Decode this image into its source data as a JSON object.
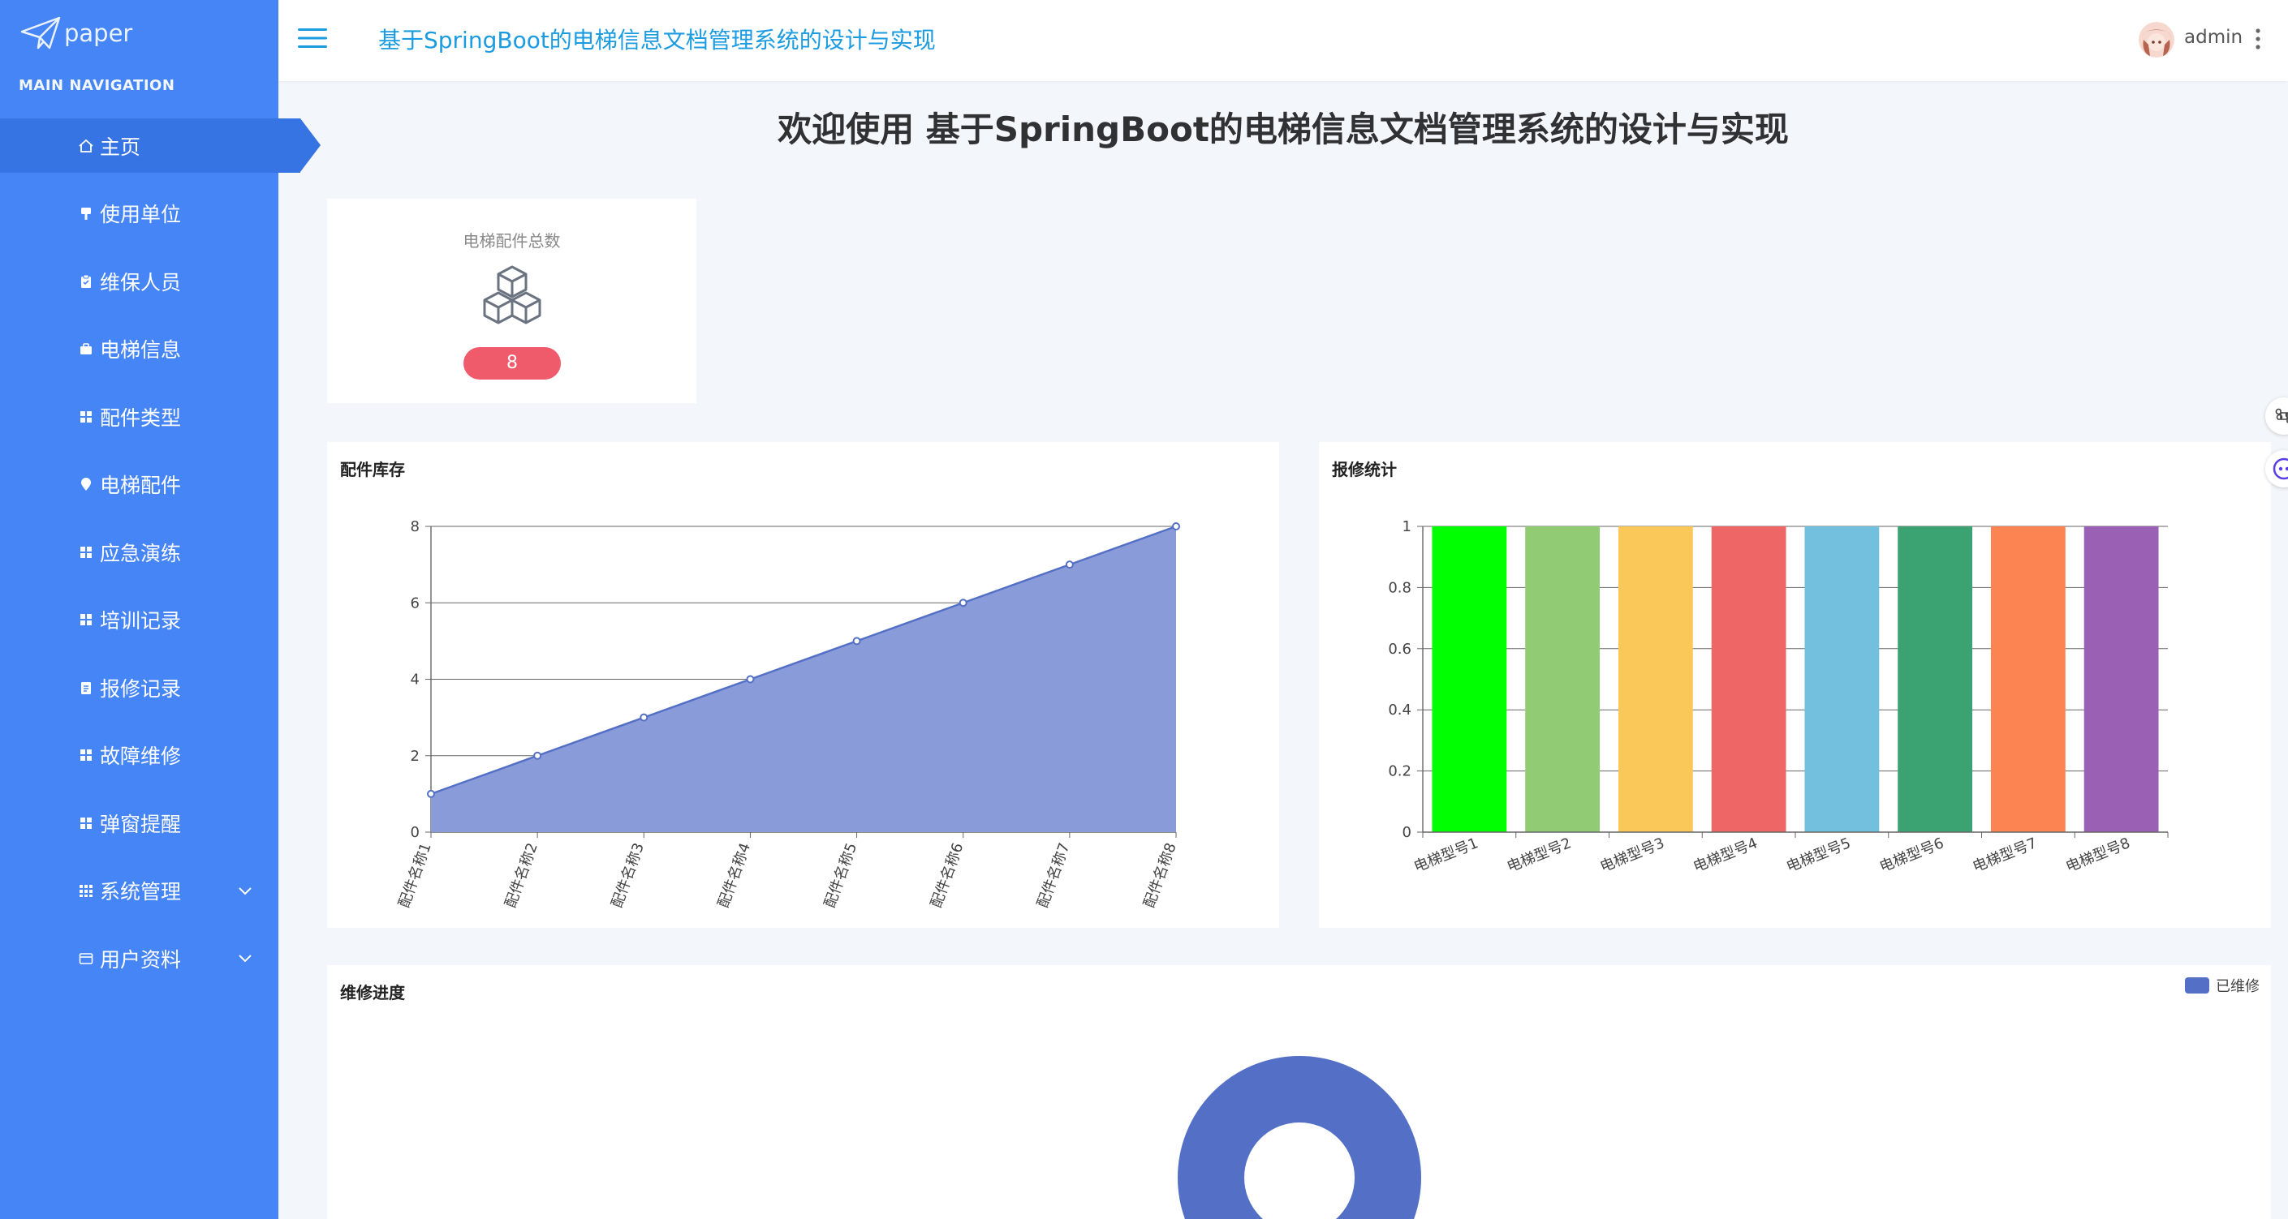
{
  "sidebar": {
    "logo_text": "paper",
    "heading": "MAIN NAVIGATION",
    "items": [
      {
        "label": "主页",
        "icon": "home-icon",
        "active": true
      },
      {
        "label": "使用单位",
        "icon": "flag-icon"
      },
      {
        "label": "维保人员",
        "icon": "clipboard-icon"
      },
      {
        "label": "电梯信息",
        "icon": "briefcase-icon"
      },
      {
        "label": "配件类型",
        "icon": "grid-icon"
      },
      {
        "label": "电梯配件",
        "icon": "map-pin-icon"
      },
      {
        "label": "应急演练",
        "icon": "grid-icon"
      },
      {
        "label": "培训记录",
        "icon": "grid-icon"
      },
      {
        "label": "报修记录",
        "icon": "document-icon"
      },
      {
        "label": "故障维修",
        "icon": "grid-icon"
      },
      {
        "label": "弹窗提醒",
        "icon": "grid-icon"
      },
      {
        "label": "系统管理",
        "icon": "grid-icon",
        "expandable": true
      },
      {
        "label": "用户资料",
        "icon": "card-icon",
        "expandable": true
      }
    ]
  },
  "header": {
    "title": "基于SpringBoot的电梯信息文档管理系统的设计与实现",
    "username": "admin"
  },
  "main": {
    "welcome": "欢迎使用 基于SpringBoot的电梯信息文档管理系统的设计与实现",
    "stat": {
      "label": "电梯配件总数",
      "value": "8"
    }
  },
  "colors": {
    "sidebar": "#4585f5",
    "sidebar_active": "#3674e4",
    "header_title": "#1b9be0",
    "badge": "#f05b6c",
    "line_fill": "#8a9bd9",
    "line_stroke": "#5470c6"
  },
  "chart_data": [
    {
      "type": "area",
      "title": "配件库存",
      "categories": [
        "配件名称1",
        "配件名称2",
        "配件名称3",
        "配件名称4",
        "配件名称5",
        "配件名称6",
        "配件名称7",
        "配件名称8"
      ],
      "values": [
        1,
        2,
        3,
        4,
        5,
        6,
        7,
        8
      ],
      "ylim": [
        0,
        8
      ],
      "yticks": [
        0,
        2,
        4,
        6,
        8
      ],
      "grid": true
    },
    {
      "type": "bar",
      "title": "报修统计",
      "categories": [
        "电梯型号1",
        "电梯型号2",
        "电梯型号3",
        "电梯型号4",
        "电梯型号5",
        "电梯型号6",
        "电梯型号7",
        "电梯型号8"
      ],
      "values": [
        1,
        1,
        1,
        1,
        1,
        1,
        1,
        1
      ],
      "colors": [
        "#00ff00",
        "#91cc75",
        "#fac858",
        "#ee6666",
        "#73c0de",
        "#3ba272",
        "#fc8452",
        "#9a60b4"
      ],
      "ylim": [
        0,
        1
      ],
      "yticks": [
        "0",
        "0.2",
        "0.4",
        "0.6",
        "0.8",
        "1"
      ],
      "grid": true
    },
    {
      "type": "pie",
      "title": "维修进度",
      "series": [
        {
          "name": "已维修",
          "values": [
            1
          ]
        }
      ],
      "legend": "top-right",
      "colors": [
        "#5470c6"
      ]
    }
  ]
}
